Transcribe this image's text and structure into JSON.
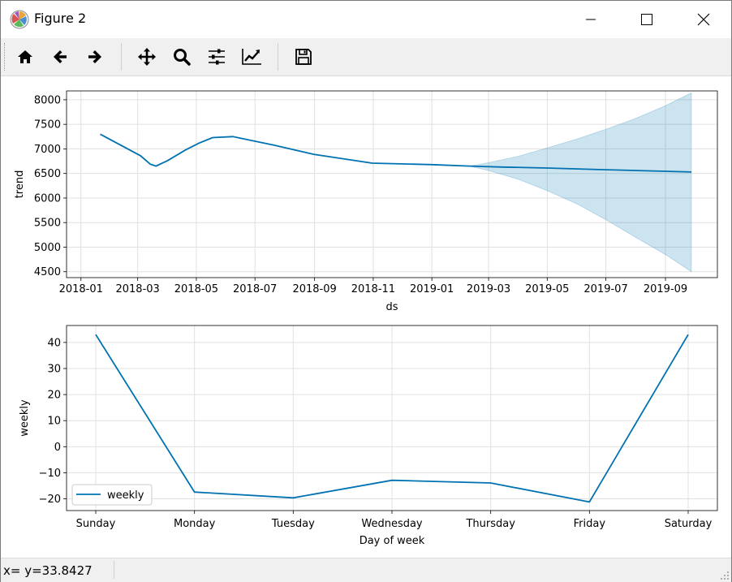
{
  "window": {
    "title": "Figure 2",
    "controls": [
      "minimize-icon",
      "maximize-icon",
      "close-icon"
    ]
  },
  "toolbar": {
    "buttons": [
      {
        "name": "home-button",
        "icon": "home-icon"
      },
      {
        "name": "back-button",
        "icon": "arrow-left-icon"
      },
      {
        "name": "forward-button",
        "icon": "arrow-right-icon"
      },
      {
        "name": "pan-button",
        "icon": "move-icon"
      },
      {
        "name": "zoom-button",
        "icon": "magnifier-icon"
      },
      {
        "name": "configure-subplots-button",
        "icon": "sliders-icon"
      },
      {
        "name": "edit-axis-button",
        "icon": "line-chart-icon"
      },
      {
        "name": "save-button",
        "icon": "floppy-disk-icon"
      }
    ]
  },
  "status": {
    "text": "x= y=33.8427"
  },
  "colors": {
    "line": "#0072B2",
    "band": "#0072B2",
    "grid": "#e0e0e0",
    "toolbar": "#f0f0f0"
  },
  "chart_data": [
    {
      "type": "line",
      "xlabel": "ds",
      "ylabel": "trend",
      "grid": true,
      "xtick_labels": [
        "2018-01",
        "2018-03",
        "2018-05",
        "2018-07",
        "2018-09",
        "2018-11",
        "2019-01",
        "2019-03",
        "2019-05",
        "2019-07",
        "2019-09"
      ],
      "ytick_labels": [
        "4500",
        "5000",
        "5500",
        "6000",
        "6500",
        "7000",
        "7500",
        "8000"
      ],
      "xlim": [
        "2017-12-17",
        "2019-10-25"
      ],
      "ylim": [
        4380,
        8180
      ],
      "series": [
        {
          "x": [
            "2018-01-21",
            "2018-03-04",
            "2018-03-14",
            "2018-03-20",
            "2018-04-01",
            "2018-04-20",
            "2018-05-04",
            "2018-05-18",
            "2018-06-08",
            "2018-06-25",
            "2018-07-20",
            "2018-08-31",
            "2018-10-31",
            "2019-01-01",
            "2019-02-09",
            "2019-03-15",
            "2019-05-01",
            "2019-07-01",
            "2019-09-28"
          ],
          "y": [
            7300,
            6860,
            6690,
            6650,
            6760,
            6980,
            7120,
            7230,
            7250,
            7180,
            7080,
            6890,
            6710,
            6680,
            6650,
            6630,
            6610,
            6575,
            6530
          ]
        }
      ],
      "uncertainty_band": {
        "x": [
          "2019-02-09",
          "2019-03-01",
          "2019-04-01",
          "2019-05-01",
          "2019-06-01",
          "2019-07-01",
          "2019-08-01",
          "2019-09-01",
          "2019-09-28"
        ],
        "upper": [
          6650,
          6720,
          6850,
          7020,
          7200,
          7400,
          7620,
          7880,
          8140
        ],
        "lower": [
          6650,
          6560,
          6380,
          6150,
          5880,
          5560,
          5200,
          4850,
          4500
        ]
      }
    },
    {
      "type": "line",
      "xlabel": "Day of week",
      "ylabel": "weekly",
      "grid": true,
      "legend": "lower-left",
      "categories": [
        "Sunday",
        "Monday",
        "Tuesday",
        "Wednesday",
        "Thursday",
        "Friday",
        "Saturday"
      ],
      "ytick_labels": [
        "−20",
        "−10",
        "0",
        "10",
        "20",
        "30",
        "40"
      ],
      "ylim": [
        -24.5,
        46.5
      ],
      "series": [
        {
          "name": "weekly",
          "values": [
            43.0,
            -17.4,
            -19.6,
            -12.9,
            -13.9,
            -21.2,
            43.0
          ]
        }
      ]
    }
  ]
}
